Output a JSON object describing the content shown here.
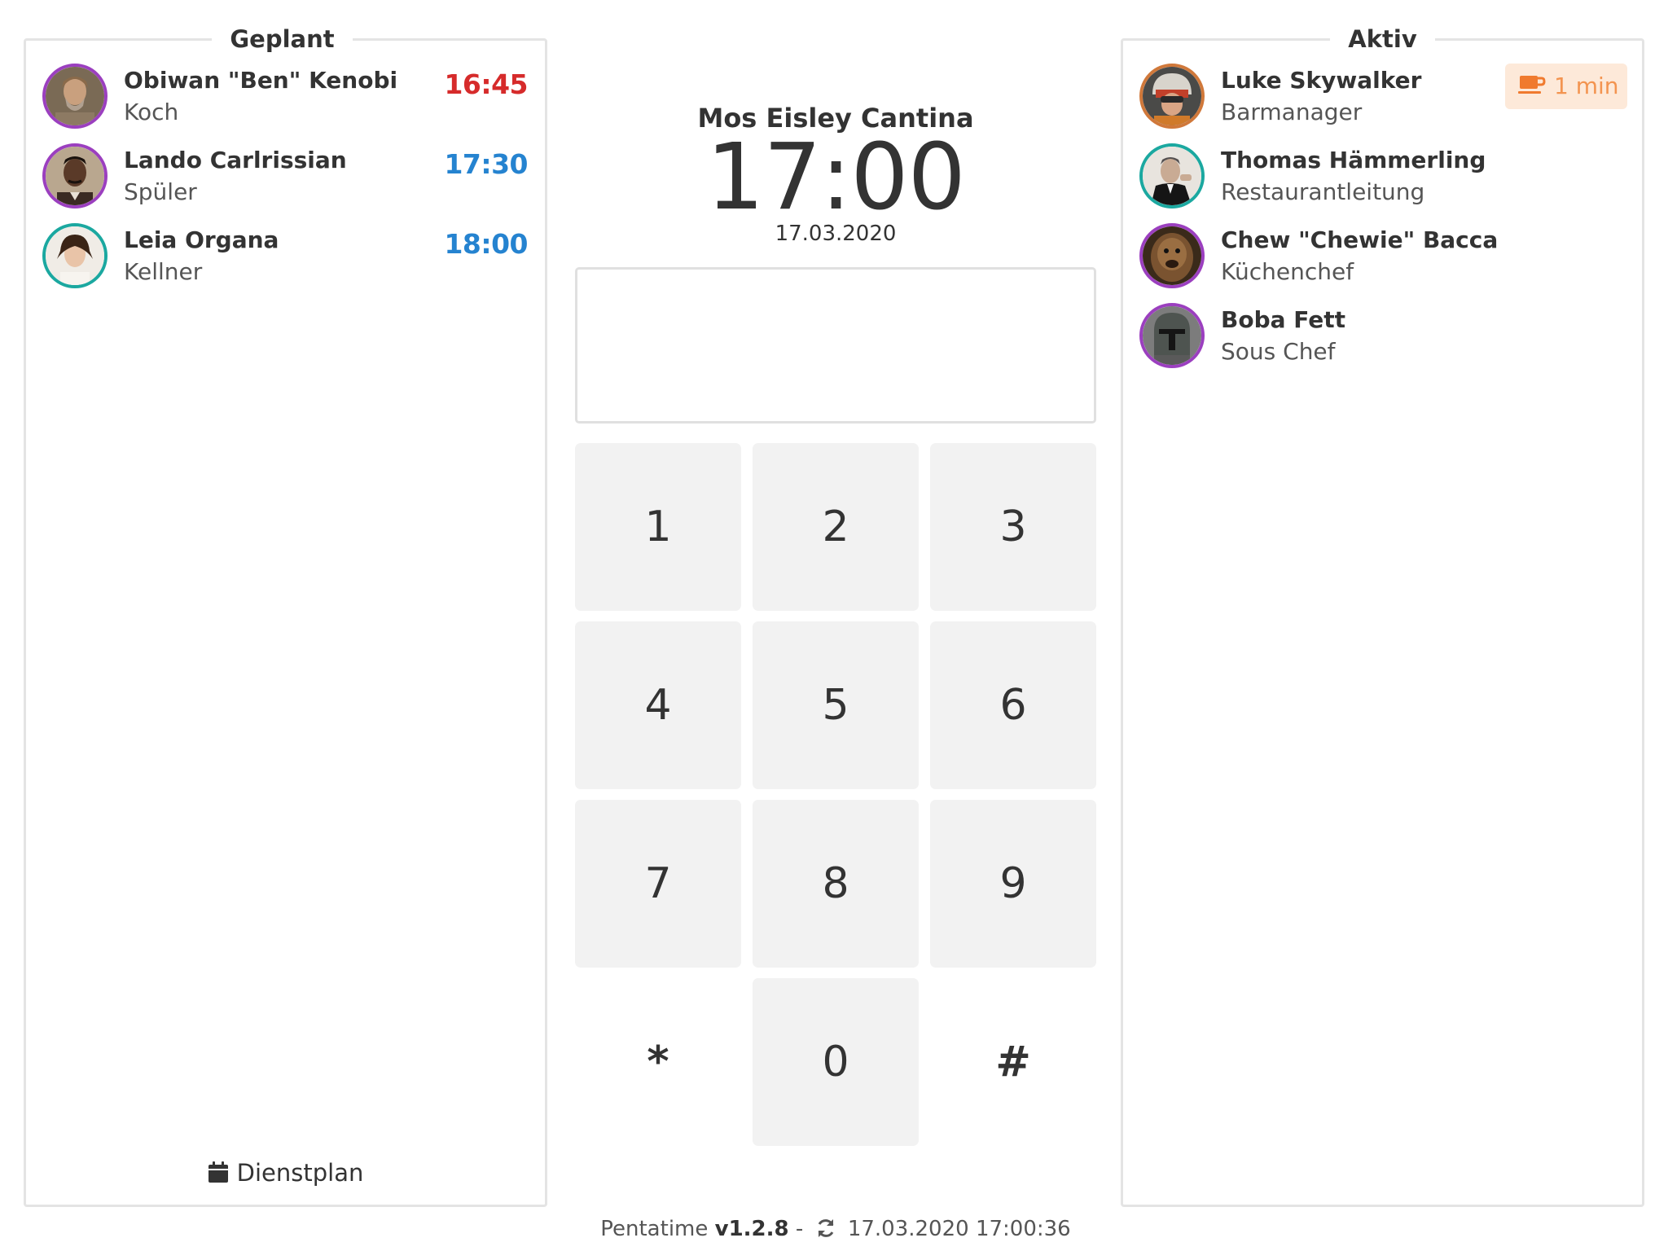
{
  "planned": {
    "title": "Geplant",
    "people": [
      {
        "name": "Obiwan \"Ben\" Kenobi",
        "role": "Koch",
        "time": "16:45",
        "time_color": "#d62b2b"
      },
      {
        "name": "Lando Carlrissian",
        "role": "Spüler",
        "time": "17:30",
        "time_color": "#2583d0"
      },
      {
        "name": "Leia Organa",
        "role": "Kellner",
        "time": "18:00",
        "time_color": "#2583d0"
      }
    ],
    "schedule_label": "Dienstplan",
    "schedule_icon": "calendar-icon"
  },
  "clock": {
    "location": "Mos Eisley Cantina",
    "time": "17:00",
    "date": "17.03.2020"
  },
  "pin": {
    "value": ""
  },
  "keypad": {
    "keys": [
      "1",
      "2",
      "3",
      "4",
      "5",
      "6",
      "7",
      "8",
      "9",
      "*",
      "0",
      "#"
    ]
  },
  "active": {
    "title": "Aktiv",
    "people": [
      {
        "name": "Luke Skywalker",
        "role": "Barmanager",
        "break_icon": "coffee-cup-icon",
        "break_label": "1 min",
        "break_color": "#f39450"
      },
      {
        "name": "Thomas Hämmerling",
        "role": "Restaurantleitung"
      },
      {
        "name": "Chew \"Chewie\" Bacca",
        "role": "Küchenchef"
      },
      {
        "name": "Boba Fett",
        "role": "Sous Chef"
      }
    ]
  },
  "footer": {
    "app_name": "Pentatime",
    "version": "v1.2.8",
    "separator": "-",
    "sync_icon": "refresh-icon",
    "last_sync": "17.03.2020 17:00:36"
  },
  "colors": {
    "late": "#d62b2b",
    "scheduled": "#2583d0",
    "break": "#f39450",
    "key_background": "#f2f2f2"
  }
}
